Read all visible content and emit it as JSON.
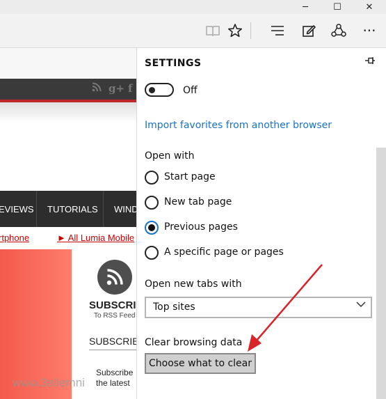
{
  "window": {
    "minimize": "─",
    "maximize": "☐",
    "close": "✕"
  },
  "toolbar": {
    "reading_view_icon": "book-icon",
    "favorite_icon": "star-icon",
    "hub_icon": "hub-icon",
    "note_icon": "web-note-icon",
    "share_icon": "share-icon",
    "more_label": "···"
  },
  "page": {
    "social": [
      "g+",
      "f"
    ],
    "nav": [
      "EVIEWS",
      "TUTORIALS",
      "WIND"
    ],
    "red_links": [
      "rtphone",
      "► All Lumia Mobile"
    ],
    "subscribe_big": "SUBSCRIB",
    "to_rss": "To RSS Feed",
    "subscribe_header": "SUBSCRIB",
    "subscribe_text_1": "Subscribe",
    "subscribe_text_2": "the latest",
    "watermark": "www.3allemni"
  },
  "settings": {
    "title": "SETTINGS",
    "toggle_label": "Off",
    "import_link": "Import favorites from another browser",
    "open_with_label": "Open with",
    "open_with_options": [
      "Start page",
      "New tab page",
      "Previous pages",
      "A specific page or pages"
    ],
    "open_with_selected": "Previous pages",
    "new_tabs_label": "Open new tabs with",
    "new_tabs_value": "Top sites",
    "clear_label": "Clear browsing data",
    "clear_button": "Choose what to clear"
  },
  "colors": {
    "accent": "#1a73c8",
    "arrow": "#d9222a",
    "nav_bg": "#2d2d2d",
    "link_red": "#cc0000"
  }
}
